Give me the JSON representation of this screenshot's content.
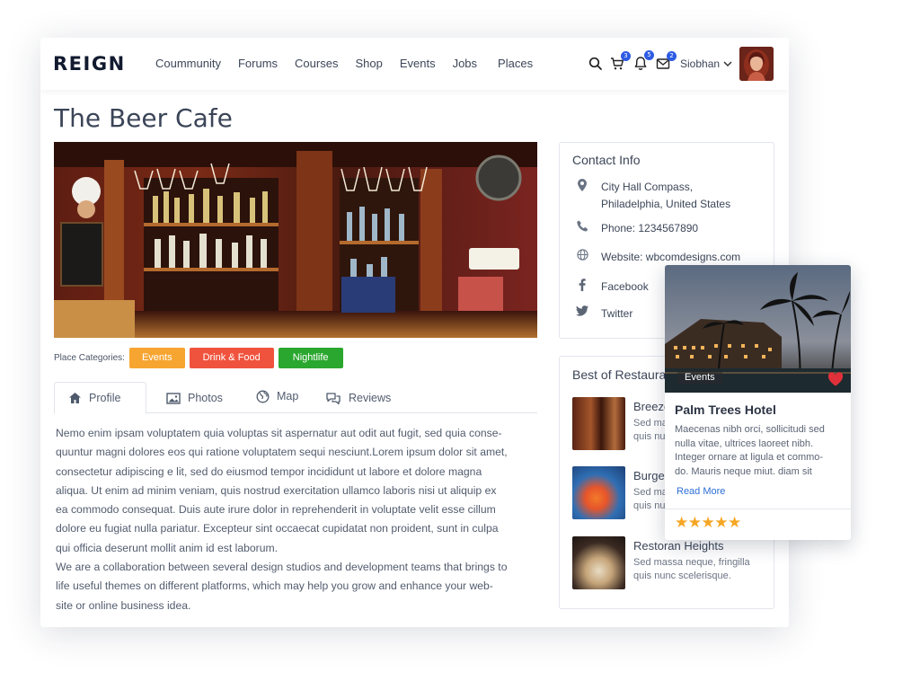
{
  "header": {
    "logo": "REIGN",
    "nav": [
      "Coummunity",
      "Forums",
      "Courses",
      "Shop",
      "Events",
      "Jobs",
      "Places"
    ],
    "cart_count": "3",
    "notification_count": "5",
    "message_count": "2",
    "username": "Siobhan"
  },
  "page": {
    "title": "The Beer Cafe",
    "categories_label": "Place Categories:",
    "categories": [
      {
        "label": "Events",
        "color": "#f7a531"
      },
      {
        "label": "Drink & Food",
        "color": "#f0533d"
      },
      {
        "label": "Nightlife",
        "color": "#2aa72e"
      }
    ],
    "tabs": [
      "Profile",
      "Photos",
      "Map",
      "Reviews"
    ],
    "description": [
      "Nemo enim ipsam voluptatem quia voluptas sit aspernatur aut odit aut fugit, sed quia conse-",
      "quuntur magni dolores eos qui ratione voluptatem sequi nesciunt.Lorem ipsum dolor sit amet,",
      "consectetur adipiscing e lit, sed do eiusmod tempor incididunt ut labore et dolore magna",
      "aliqua. Ut enim ad minim veniam, quis nostrud exercitation ullamco laboris nisi ut aliquip ex",
      "ea commodo consequat. Duis aute irure dolor in reprehenderit in voluptate velit esse cillum",
      "dolore eu fugiat nulla pariatur. Excepteur sint occaecat cupidatat non proident, sunt in culpa",
      "qui officia deserunt mollit anim id est laborum.",
      "We are a collaboration between several design studios and development teams that brings to",
      "life useful themes on different platforms, which may help you grow and enhance your web-",
      "site or online business idea."
    ]
  },
  "contact": {
    "title": "Contact Info",
    "address_line1": "City Hall Compass,",
    "address_line2": "Philadelphia, United States",
    "phone": "Phone: 1234567890",
    "website": "Website: wbcomdesigns.com",
    "facebook": "Facebook",
    "twitter": "Twitter"
  },
  "restaurants": {
    "title": "Best of Restaurants",
    "items": [
      {
        "name": "Breeze",
        "text": "Sed ma / quis nu"
      },
      {
        "name": "Burger",
        "text": "Sed ma / quis nu"
      },
      {
        "name": "Restoran Heights",
        "text_line1": "Sed massa neque, fringilla",
        "text_line2": "quis nunc scelerisque."
      }
    ],
    "item1_line1": "Sed ma",
    "item1_line2": "quis nu",
    "item2_line1": "Sed ma",
    "item2_line2": "quis nu"
  },
  "hotel_card": {
    "tag": "Events",
    "title": "Palm Trees Hotel",
    "text_lines": [
      "Maecenas nibh orci, sollicitudi sed",
      "nulla vitae, ultrices laoreet nibh.",
      "Integer ornare at ligula et commo-",
      "do. Mauris neque miut. diam sit"
    ],
    "link": "Read More",
    "rating": 5,
    "stars": "★★★★★"
  },
  "colors": {
    "accent": "#2d5be3",
    "link": "#2d6fd8",
    "star": "#f5a623",
    "heart": "#e0313a"
  }
}
